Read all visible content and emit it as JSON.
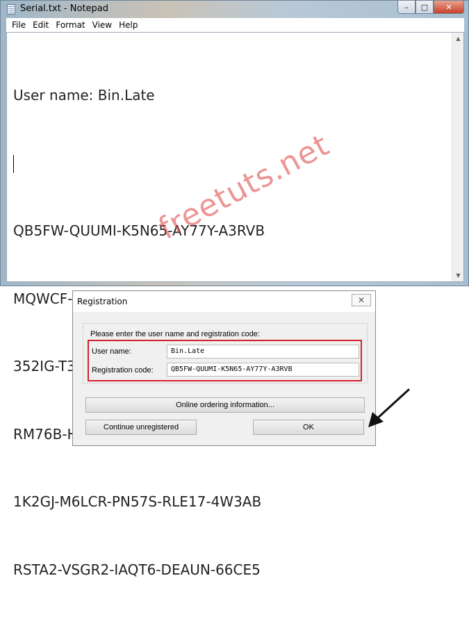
{
  "notepad": {
    "title": "Serial.txt - Notepad",
    "menu": [
      "File",
      "Edit",
      "Format",
      "View",
      "Help"
    ],
    "window_buttons": {
      "minimize": "–",
      "maximize": "□",
      "close": "✕"
    },
    "lines": [
      "User name: Bin.Late",
      "",
      "QB5FW-QUUMI-K5N65-AY77Y-A3RVB",
      "MQWCF-M8RGX-9GYYP-RXUD8-VS8M1",
      "352IG-T3WGF-FTQZ3-9BKNR-BTHKB",
      "RM76B-HFHNF-AEC4T-1LTPZ-X87SU",
      "1K2GJ-M6LCR-PN57S-RLE17-4W3AB",
      "RSTA2-VSGR2-IAQT6-DEAUN-66CE5"
    ],
    "watermark": "freetuts.net"
  },
  "registration": {
    "title": "Registration",
    "close_glyph": "✕",
    "prompt": "Please enter the user name and registration code:",
    "user_name_label": "User name:",
    "user_name_value": "Bin.Late",
    "code_label": "Registration code:",
    "code_value": "QB5FW-QUUMI-K5N65-AY77Y-A3RVB",
    "online_button": "Online ordering information...",
    "continue_button": "Continue unregistered",
    "ok_button": "OK"
  },
  "colors": {
    "highlight_frame": "#d1202b",
    "watermark": "#dc3c3c"
  }
}
